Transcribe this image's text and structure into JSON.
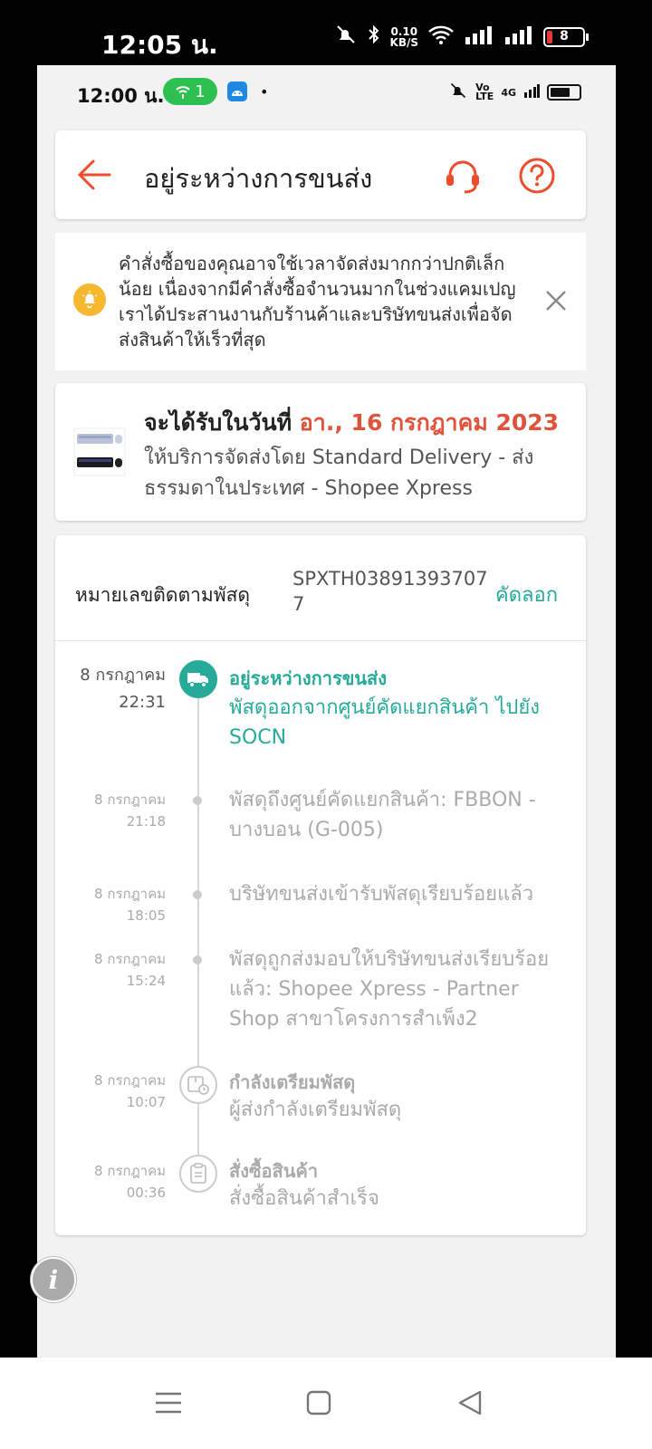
{
  "outer_status": {
    "time": "12:05 น.",
    "net_speed_value": "0.10",
    "net_speed_unit": "KB/S",
    "battery": "8"
  },
  "inner_status": {
    "time": "12:00 น.",
    "hotspot_count": "1",
    "dot": "•",
    "network": "4G"
  },
  "header": {
    "title": "อยู่ระหว่างการขนส่ง"
  },
  "notice": {
    "text": "คำสั่งซื้อของคุณอาจใช้เวลาจัดส่งมากกว่าปกติเล็กน้อย เนื่องจากมีคำสั่งซื้อจำนวนมากในช่วงแคมเปญ เราได้ประสานงานกับร้านค้าและบริษัทขนส่งเพื่อจัดส่งสินค้าให้เร็วที่สุด"
  },
  "delivery": {
    "eta_prefix": "จะได้รับในวันที่ ",
    "eta_date": "อา., 16 กรกฎาคม 2023",
    "service": "ให้บริการจัดส่งโดย Standard Delivery - ส่งธรรมดาในประเทศ - Shopee Xpress"
  },
  "tracking": {
    "label": "หมายเลขติดตามพัสดุ",
    "number": "SPXTH038913937077",
    "copy_label": "คัดลอก",
    "events": [
      {
        "date": "8 กรกฎาคม",
        "time": "22:31",
        "title": "อยู่ระหว่างการขนส่ง",
        "desc": "พัสดุออกจากศูนย์คัดแยกสินค้า ไปยัง SOCN"
      },
      {
        "date": "8 กรกฎาคม",
        "time": "21:18",
        "title": "",
        "desc": "พัสดุถึงศูนย์คัดแยกสินค้า: FBBON - บางบอน (G-005)"
      },
      {
        "date": "8 กรกฎาคม",
        "time": "18:05",
        "title": "",
        "desc": "บริษัทขนส่งเข้ารับพัสดุเรียบร้อยแล้ว"
      },
      {
        "date": "8 กรกฎาคม",
        "time": "15:24",
        "title": "",
        "desc": "พัสดุถูกส่งมอบให้บริษัทขนส่งเรียบร้อยแล้ว: Shopee Xpress - Partner Shop สาขาโครงการสำเพ็ง2"
      },
      {
        "date": "8 กรกฎาคม",
        "time": "10:07",
        "title": "กำลังเตรียมพัสดุ",
        "desc": "ผู้ส่งกำลังเตรียมพัสดุ"
      },
      {
        "date": "8 กรกฎาคม",
        "time": "00:36",
        "title": "สั่งซื้อสินค้า",
        "desc": "สั่งซื้อสินค้าสำเร็จ"
      }
    ]
  },
  "colors": {
    "accent": "#26aa99",
    "brand": "#ee4d2d",
    "eta": "#e0533a",
    "bell": "#f5b82e"
  },
  "icons": [
    "back-arrow-icon",
    "headset-icon",
    "question-icon",
    "bell-icon",
    "close-icon",
    "truck-icon",
    "package-clock-icon",
    "clipboard-icon",
    "info-icon"
  ]
}
